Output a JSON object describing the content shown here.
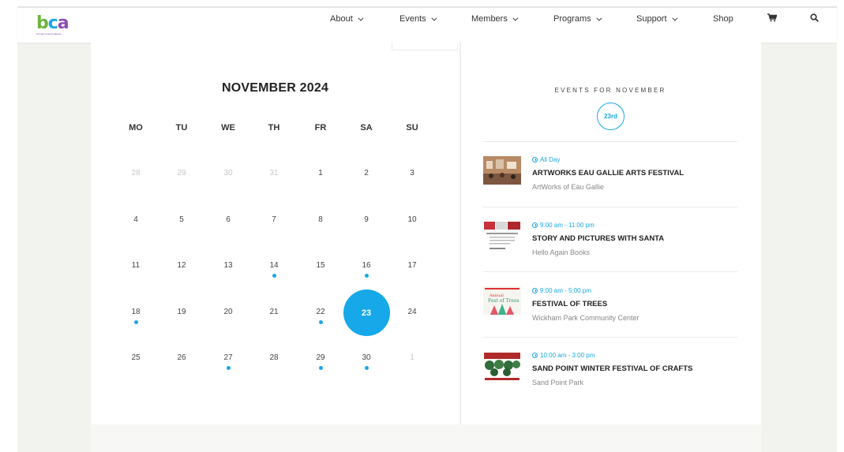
{
  "header": {
    "logo_text": "bca",
    "logo_tagline": "brevard cultural alliance",
    "nav": [
      {
        "label": "About"
      },
      {
        "label": "Events"
      },
      {
        "label": "Members"
      },
      {
        "label": "Programs"
      },
      {
        "label": "Support"
      },
      {
        "label": "Shop"
      }
    ],
    "icons": {
      "cart": "cart-icon",
      "search": "search-icon"
    }
  },
  "calendar": {
    "title": "NOVEMBER 2024",
    "weekdays": [
      "MO",
      "TU",
      "WE",
      "TH",
      "FR",
      "SA",
      "SU"
    ],
    "weeks": [
      [
        {
          "d": "28",
          "muted": true
        },
        {
          "d": "29",
          "muted": true
        },
        {
          "d": "30",
          "muted": true
        },
        {
          "d": "31",
          "muted": true
        },
        {
          "d": "1"
        },
        {
          "d": "2"
        },
        {
          "d": "3"
        }
      ],
      [
        {
          "d": "4"
        },
        {
          "d": "5"
        },
        {
          "d": "6"
        },
        {
          "d": "7"
        },
        {
          "d": "8"
        },
        {
          "d": "9"
        },
        {
          "d": "10"
        }
      ],
      [
        {
          "d": "11"
        },
        {
          "d": "12"
        },
        {
          "d": "13"
        },
        {
          "d": "14",
          "event": true
        },
        {
          "d": "15"
        },
        {
          "d": "16",
          "event": true
        },
        {
          "d": "17"
        }
      ],
      [
        {
          "d": "18",
          "event": true
        },
        {
          "d": "19"
        },
        {
          "d": "20"
        },
        {
          "d": "21"
        },
        {
          "d": "22",
          "event": true
        },
        {
          "d": "23",
          "selected": true
        },
        {
          "d": "24"
        }
      ],
      [
        {
          "d": "25"
        },
        {
          "d": "26"
        },
        {
          "d": "27",
          "event": true
        },
        {
          "d": "28"
        },
        {
          "d": "29",
          "event": true
        },
        {
          "d": "30",
          "event": true
        },
        {
          "d": "1",
          "muted": true
        }
      ]
    ],
    "accent_color": "#16a8e8"
  },
  "events_panel": {
    "heading": "EVENTS FOR NOVEMBER",
    "date_badge": "23rd",
    "events": [
      {
        "time": "All Day",
        "title": "ARTWORKS EAU GALLIE ARTS FESTIVAL",
        "venue": "ArtWorks of Eau Gallie"
      },
      {
        "time": "9:00 am - 11:00 pm",
        "title": "STORY AND PICTURES WITH SANTA",
        "venue": "Hello Again Books"
      },
      {
        "time": "9:00 am - 5:00 pm",
        "title": "FESTIVAL OF TREES",
        "venue": "Wickham Park Community Center"
      },
      {
        "time": "10:00 am - 3:00 pm",
        "title": "SAND POINT WINTER FESTIVAL OF CRAFTS",
        "venue": "Sand Point Park"
      }
    ]
  }
}
